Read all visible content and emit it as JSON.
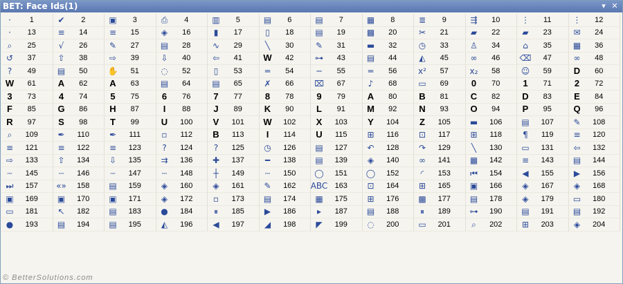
{
  "window": {
    "title": "BET: Face Ids(1)",
    "dropdown_glyph": "▾",
    "close_glyph": "✕"
  },
  "footer": "© BetterSolutions.com",
  "rows": [
    [
      {
        "i": "·",
        "n": "1"
      },
      {
        "i": "✔",
        "n": "2"
      },
      {
        "i": "▣",
        "n": "3"
      },
      {
        "i": "⎙",
        "n": "4"
      },
      {
        "i": "▥",
        "n": "5"
      },
      {
        "i": "▤",
        "n": "6"
      },
      {
        "i": "▤",
        "n": "7"
      },
      {
        "i": "▦",
        "n": "8"
      },
      {
        "i": "≣",
        "n": "9"
      },
      {
        "i": "⇶",
        "n": "10"
      },
      {
        "i": "⋮",
        "n": "11"
      },
      {
        "i": "⋮",
        "n": "12"
      }
    ],
    [
      {
        "i": "·",
        "n": "13"
      },
      {
        "i": "≡",
        "n": "14"
      },
      {
        "i": "≡",
        "n": "15"
      },
      {
        "i": "◈",
        "n": "16"
      },
      {
        "i": "▮",
        "n": "17"
      },
      {
        "i": "▯",
        "n": "18"
      },
      {
        "i": "▤",
        "n": "19"
      },
      {
        "i": "▩",
        "n": "20"
      },
      {
        "i": "✂",
        "n": "21"
      },
      {
        "i": "▰",
        "n": "22"
      },
      {
        "i": "▰",
        "n": "23"
      },
      {
        "i": "✉",
        "n": "24"
      }
    ],
    [
      {
        "i": "⌕",
        "n": "25"
      },
      {
        "i": "√",
        "n": "26"
      },
      {
        "i": "✎",
        "n": "27"
      },
      {
        "i": "▤",
        "n": "28"
      },
      {
        "i": "∿",
        "n": "29"
      },
      {
        "i": "╲",
        "n": "30"
      },
      {
        "i": "✎",
        "n": "31"
      },
      {
        "i": "▬",
        "n": "32"
      },
      {
        "i": "◷",
        "n": "33"
      },
      {
        "i": "♙",
        "n": "34"
      },
      {
        "i": "⌂",
        "n": "35"
      },
      {
        "i": "▦",
        "n": "36"
      }
    ],
    [
      {
        "i": "↺",
        "n": "37"
      },
      {
        "i": "⇧",
        "n": "38"
      },
      {
        "i": "⇨",
        "n": "39"
      },
      {
        "i": "⇩",
        "n": "40"
      },
      {
        "i": "⇦",
        "n": "41"
      },
      {
        "i": "W",
        "n": "42"
      },
      {
        "i": "⊶",
        "n": "43"
      },
      {
        "i": "▤",
        "n": "44"
      },
      {
        "i": "◭",
        "n": "45"
      },
      {
        "i": "∞",
        "n": "46"
      },
      {
        "i": "⌫",
        "n": "47"
      },
      {
        "i": "∞",
        "n": "48"
      }
    ],
    [
      {
        "i": "?",
        "n": "49"
      },
      {
        "i": "▤",
        "n": "50"
      },
      {
        "i": "✋",
        "n": "51"
      },
      {
        "i": "◌",
        "n": "52"
      },
      {
        "i": "▯",
        "n": "53"
      },
      {
        "i": "═",
        "n": "54"
      },
      {
        "i": "─",
        "n": "55"
      },
      {
        "i": "═",
        "n": "56"
      },
      {
        "i": "x²",
        "n": "57"
      },
      {
        "i": "x₂",
        "n": "58"
      },
      {
        "i": "☺",
        "n": "59"
      },
      {
        "i": "D",
        "n": "60"
      }
    ],
    [
      {
        "i": "W",
        "n": "61"
      },
      {
        "i": "A",
        "n": "62"
      },
      {
        "i": "A",
        "n": "63"
      },
      {
        "i": "▤",
        "n": "64"
      },
      {
        "i": "▤",
        "n": "65"
      },
      {
        "i": "✗",
        "n": "66"
      },
      {
        "i": "⌧",
        "n": "67"
      },
      {
        "i": "♪",
        "n": "68"
      },
      {
        "i": "▭",
        "n": "69"
      },
      {
        "i": "0",
        "n": "70"
      },
      {
        "i": "1",
        "n": "71"
      },
      {
        "i": "2",
        "n": "72"
      }
    ],
    [
      {
        "i": "3",
        "n": "73"
      },
      {
        "i": "4",
        "n": "74"
      },
      {
        "i": "5",
        "n": "75"
      },
      {
        "i": "6",
        "n": "76"
      },
      {
        "i": "7",
        "n": "77"
      },
      {
        "i": "8",
        "n": "78"
      },
      {
        "i": "9",
        "n": "79"
      },
      {
        "i": "A",
        "n": "80"
      },
      {
        "i": "B",
        "n": "81"
      },
      {
        "i": "C",
        "n": "82"
      },
      {
        "i": "D",
        "n": "83"
      },
      {
        "i": "E",
        "n": "84"
      }
    ],
    [
      {
        "i": "F",
        "n": "85"
      },
      {
        "i": "G",
        "n": "86"
      },
      {
        "i": "H",
        "n": "87"
      },
      {
        "i": "I",
        "n": "88"
      },
      {
        "i": "J",
        "n": "89"
      },
      {
        "i": "K",
        "n": "90"
      },
      {
        "i": "L",
        "n": "91"
      },
      {
        "i": "M",
        "n": "92"
      },
      {
        "i": "N",
        "n": "93"
      },
      {
        "i": "O",
        "n": "94"
      },
      {
        "i": "P",
        "n": "95"
      },
      {
        "i": "Q",
        "n": "96"
      }
    ],
    [
      {
        "i": "R",
        "n": "97"
      },
      {
        "i": "S",
        "n": "98"
      },
      {
        "i": "T",
        "n": "99"
      },
      {
        "i": "U",
        "n": "100"
      },
      {
        "i": "V",
        "n": "101"
      },
      {
        "i": "W",
        "n": "102"
      },
      {
        "i": "X",
        "n": "103"
      },
      {
        "i": "Y",
        "n": "104"
      },
      {
        "i": "Z",
        "n": "105"
      },
      {
        "i": "▬",
        "n": "106"
      },
      {
        "i": "▤",
        "n": "107"
      },
      {
        "i": "✎",
        "n": "108"
      }
    ],
    [
      {
        "i": "⌕",
        "n": "109"
      },
      {
        "i": "✒",
        "n": "110"
      },
      {
        "i": "✒",
        "n": "111"
      },
      {
        "i": "▫",
        "n": "112"
      },
      {
        "i": "B",
        "n": "113"
      },
      {
        "i": "I",
        "n": "114"
      },
      {
        "i": "U",
        "n": "115"
      },
      {
        "i": "⊞",
        "n": "116"
      },
      {
        "i": "⊡",
        "n": "117"
      },
      {
        "i": "⊞",
        "n": "118"
      },
      {
        "i": "¶",
        "n": "119"
      },
      {
        "i": "≡",
        "n": "120"
      }
    ],
    [
      {
        "i": "≡",
        "n": "121"
      },
      {
        "i": "≡",
        "n": "122"
      },
      {
        "i": "≡",
        "n": "123"
      },
      {
        "i": "?",
        "n": "124"
      },
      {
        "i": "?",
        "n": "125"
      },
      {
        "i": "◷",
        "n": "126"
      },
      {
        "i": "▤",
        "n": "127"
      },
      {
        "i": "↶",
        "n": "128"
      },
      {
        "i": "↷",
        "n": "129"
      },
      {
        "i": "╲",
        "n": "130"
      },
      {
        "i": "▭",
        "n": "131"
      },
      {
        "i": "⇦",
        "n": "132"
      }
    ],
    [
      {
        "i": "⇨",
        "n": "133"
      },
      {
        "i": "⇧",
        "n": "134"
      },
      {
        "i": "⇩",
        "n": "135"
      },
      {
        "i": "⇉",
        "n": "136"
      },
      {
        "i": "✚",
        "n": "137"
      },
      {
        "i": "━",
        "n": "138"
      },
      {
        "i": "▤",
        "n": "139"
      },
      {
        "i": "◈",
        "n": "140"
      },
      {
        "i": "∞",
        "n": "141"
      },
      {
        "i": "▦",
        "n": "142"
      },
      {
        "i": "≡",
        "n": "143"
      },
      {
        "i": "▤",
        "n": "144"
      }
    ],
    [
      {
        "i": "┄",
        "n": "145"
      },
      {
        "i": "┄",
        "n": "146"
      },
      {
        "i": "┄",
        "n": "147"
      },
      {
        "i": "┄",
        "n": "148"
      },
      {
        "i": "┼",
        "n": "149"
      },
      {
        "i": "┄",
        "n": "150"
      },
      {
        "i": "◯",
        "n": "151"
      },
      {
        "i": "◯",
        "n": "152"
      },
      {
        "i": "◜",
        "n": "153"
      },
      {
        "i": "⏮",
        "n": "154"
      },
      {
        "i": "◀",
        "n": "155"
      },
      {
        "i": "▶",
        "n": "156"
      }
    ],
    [
      {
        "i": "⏭",
        "n": "157"
      },
      {
        "i": "«»",
        "n": "158"
      },
      {
        "i": "▤",
        "n": "159"
      },
      {
        "i": "◈",
        "n": "160"
      },
      {
        "i": "◈",
        "n": "161"
      },
      {
        "i": "✎",
        "n": "162"
      },
      {
        "i": "ABC",
        "n": "163"
      },
      {
        "i": "⊡",
        "n": "164"
      },
      {
        "i": "⊞",
        "n": "165"
      },
      {
        "i": "▣",
        "n": "166"
      },
      {
        "i": "◈",
        "n": "167"
      },
      {
        "i": "◈",
        "n": "168"
      }
    ],
    [
      {
        "i": "▣",
        "n": "169"
      },
      {
        "i": "▣",
        "n": "170"
      },
      {
        "i": "▣",
        "n": "171"
      },
      {
        "i": "◈",
        "n": "172"
      },
      {
        "i": "▫",
        "n": "173"
      },
      {
        "i": "▤",
        "n": "174"
      },
      {
        "i": "▦",
        "n": "175"
      },
      {
        "i": "⊞",
        "n": "176"
      },
      {
        "i": "▩",
        "n": "177"
      },
      {
        "i": "▤",
        "n": "178"
      },
      {
        "i": "◈",
        "n": "179"
      },
      {
        "i": "▭",
        "n": "180"
      }
    ],
    [
      {
        "i": "▭",
        "n": "181"
      },
      {
        "i": "↖",
        "n": "182"
      },
      {
        "i": "▤",
        "n": "183"
      },
      {
        "i": "●",
        "n": "184"
      },
      {
        "i": "⏸",
        "n": "185"
      },
      {
        "i": "▶",
        "n": "186"
      },
      {
        "i": "▸",
        "n": "187"
      },
      {
        "i": "▤",
        "n": "188"
      },
      {
        "i": "⏸",
        "n": "189"
      },
      {
        "i": "⊶",
        "n": "190"
      },
      {
        "i": "▤",
        "n": "191"
      },
      {
        "i": "▤",
        "n": "192"
      }
    ],
    [
      {
        "i": "●",
        "n": "193"
      },
      {
        "i": "▤",
        "n": "194"
      },
      {
        "i": "▤",
        "n": "195"
      },
      {
        "i": "◭",
        "n": "196"
      },
      {
        "i": "◀",
        "n": "197"
      },
      {
        "i": "◢",
        "n": "198"
      },
      {
        "i": "◤",
        "n": "199"
      },
      {
        "i": "◌",
        "n": "200"
      },
      {
        "i": "▭",
        "n": "201"
      },
      {
        "i": "⌕",
        "n": "202"
      },
      {
        "i": "⊞",
        "n": "203"
      },
      {
        "i": "◈",
        "n": "204"
      }
    ]
  ]
}
